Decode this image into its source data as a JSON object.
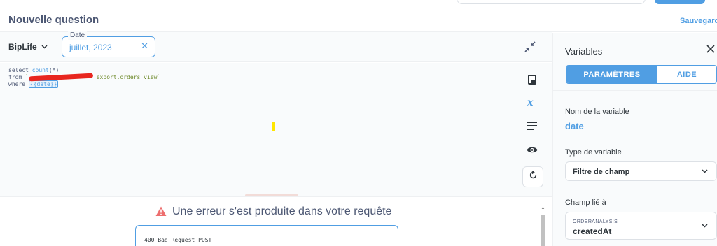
{
  "header": {
    "title": "Nouvelle question",
    "save_label": "Sauvegarde"
  },
  "filterbar": {
    "database": "BipLife",
    "date_filter": {
      "label": "Date",
      "value": "juillet, 2023",
      "clear": "✕"
    }
  },
  "editor": {
    "lines": [
      {
        "kw": "select ",
        "fn": "count",
        "rest": "(*)"
      },
      {
        "kw": "from ",
        "str_prefix": "`",
        "str_suffix": "_export.orders_view`"
      },
      {
        "kw": "where ",
        "var": "{{date}}"
      }
    ]
  },
  "error": {
    "title": "Une erreur s'est produite dans votre requête",
    "message": "400 Bad Request POST"
  },
  "panel": {
    "title": "Variables",
    "tabs": [
      {
        "label": "PARAMÈTRES",
        "active": true
      },
      {
        "label": "AIDE",
        "active": false
      }
    ],
    "variable_name_label": "Nom de la variable",
    "variable_name": "date",
    "variable_type_label": "Type de variable",
    "variable_type": "Filtre de champ",
    "linked_field_label": "Champ lié à",
    "linked_field_table": "ORDERANALYSIS",
    "linked_field": "createdAt"
  },
  "colors": {
    "accent": "#509ee3",
    "text": "#2e353b",
    "error": "#ed6e6e"
  }
}
